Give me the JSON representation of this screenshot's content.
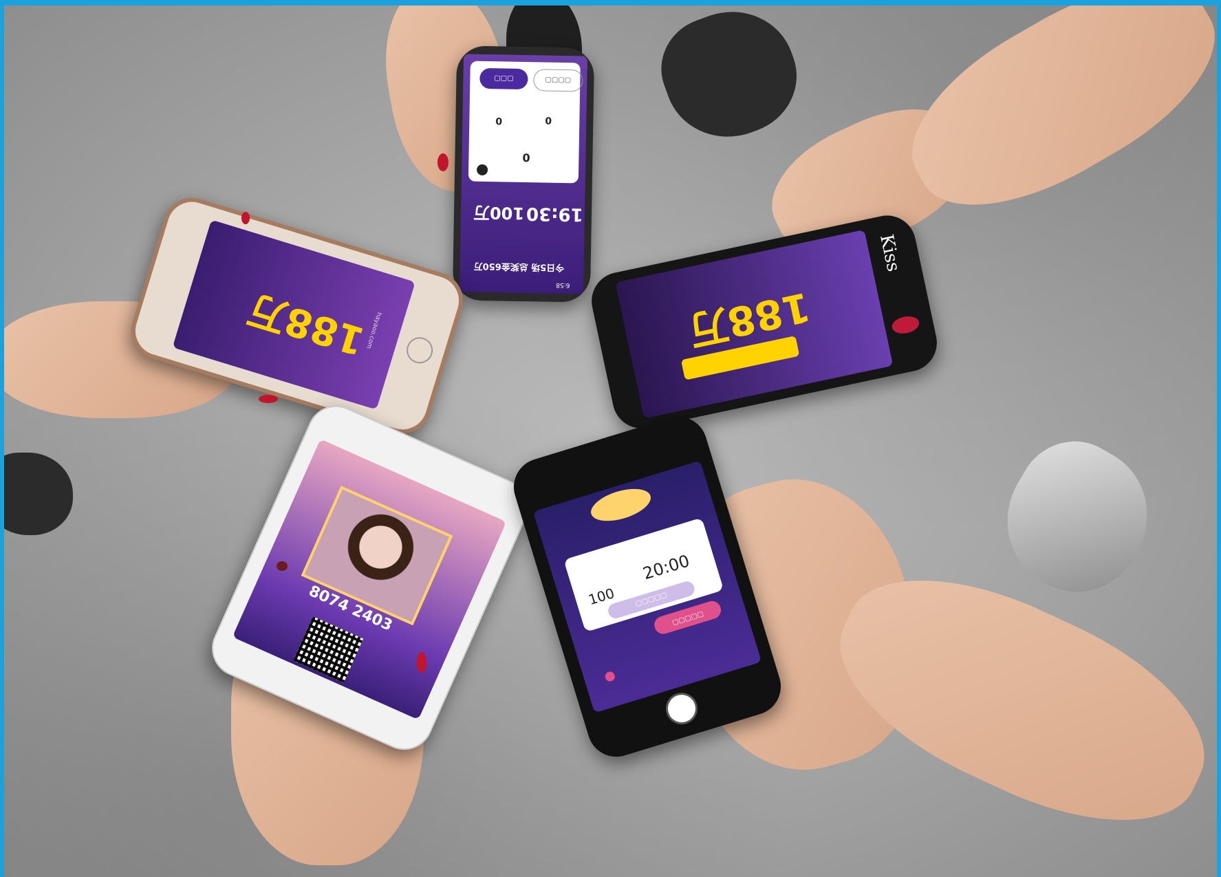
{
  "phones": {
    "top": {
      "time": "19:30",
      "prize": "100万",
      "count_left": "0",
      "count_right": "0",
      "center_count": "0",
      "sessions": "今日5场 总奖金650万",
      "clock": "6:58"
    },
    "right": {
      "amount": "188万",
      "hashtag": "Kiss"
    },
    "left": {
      "amount": "188万",
      "domain": "hayaoo.com"
    },
    "bottom_left": {
      "code": "8074 2403"
    },
    "bottom_right": {
      "total": "100",
      "time": "20:00"
    }
  },
  "colors": {
    "frame": "#1da1dd",
    "screen_purple": "#5a2f9a",
    "accent_yellow": "#ffd200"
  }
}
